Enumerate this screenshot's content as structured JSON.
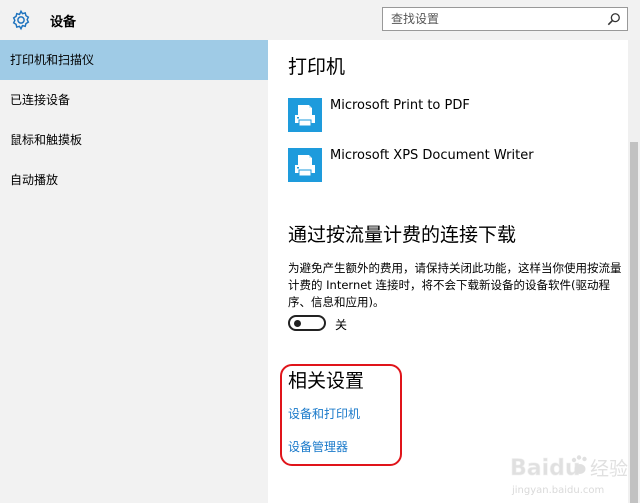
{
  "header": {
    "title": "设备",
    "search_placeholder": "查找设置",
    "gear_icon": "gear-icon",
    "search_icon": "search-icon"
  },
  "sidebar": {
    "items": [
      {
        "label": "打印机和扫描仪",
        "active": true
      },
      {
        "label": "已连接设备",
        "active": false
      },
      {
        "label": "鼠标和触摸板",
        "active": false
      },
      {
        "label": "自动播放",
        "active": false
      }
    ]
  },
  "main": {
    "printers_title": "打印机",
    "printers": [
      {
        "name": "Microsoft Print to PDF",
        "icon": "printer-icon"
      },
      {
        "name": "Microsoft XPS Document Writer",
        "icon": "printer-icon"
      }
    ],
    "metered_title": "通过按流量计费的连接下载",
    "metered_desc": "为避免产生额外的费用，请保持关闭此功能，这样当你使用按流量计费的 Internet 连接时，将不会下载新设备的设备软件(驱动程序、信息和应用)。",
    "toggle_state": "关",
    "related_title": "相关设置",
    "links": [
      "设备和打印机",
      "设备管理器"
    ]
  },
  "watermark": {
    "brand": "Baidu",
    "product": "经验",
    "url": "jingyan.baidu.com"
  },
  "colors": {
    "accent": "#1e9bdc",
    "selected": "#9fcbe6",
    "link": "#1979ca",
    "annotation": "#e0141a"
  }
}
